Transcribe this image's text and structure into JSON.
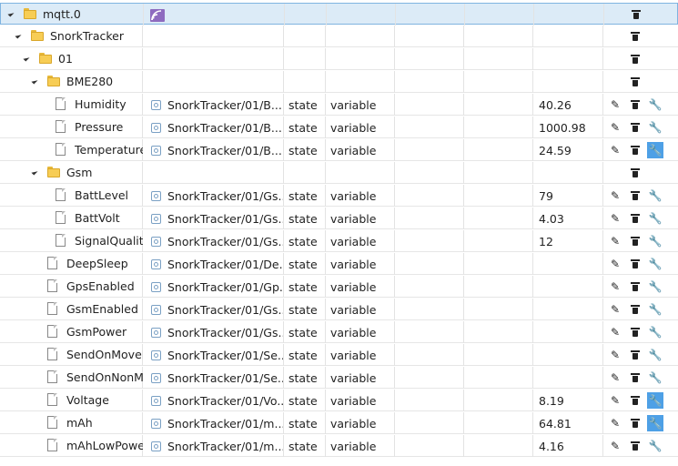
{
  "root": {
    "name": "mqtt.0"
  },
  "colors": {
    "selected_row_bg": "#dcebf7",
    "selected_row_border": "#7fb4e0",
    "active_button": "#4ea0e6",
    "folder": "#f7cd55"
  },
  "rows": [
    {
      "kind": "folder",
      "level": 0,
      "name": "mqtt.0",
      "selected": true,
      "logo": true,
      "buttons": [
        "delete"
      ]
    },
    {
      "kind": "folder",
      "level": 1,
      "name": "SnorkTracker",
      "buttons": [
        "delete"
      ]
    },
    {
      "kind": "folder",
      "level": 2,
      "name": "01",
      "buttons": [
        "delete"
      ]
    },
    {
      "kind": "folder",
      "level": 3,
      "name": "BME280",
      "buttons": [
        "delete"
      ]
    },
    {
      "kind": "state",
      "level": 4,
      "name": "Humidity",
      "id": "SnorkTracker/01/B...",
      "type": "state",
      "role": "variable",
      "value": "40.26",
      "buttons": [
        "edit",
        "delete",
        "settings"
      ],
      "settings_active": false
    },
    {
      "kind": "state",
      "level": 4,
      "name": "Pressure",
      "id": "SnorkTracker/01/B...",
      "type": "state",
      "role": "variable",
      "value": "1000.98",
      "buttons": [
        "edit",
        "delete",
        "settings"
      ],
      "settings_active": false
    },
    {
      "kind": "state",
      "level": 4,
      "name": "Temperature",
      "id": "SnorkTracker/01/B...",
      "type": "state",
      "role": "variable",
      "value": "24.59",
      "buttons": [
        "edit",
        "delete",
        "settings"
      ],
      "settings_active": true
    },
    {
      "kind": "folder",
      "level": 3,
      "name": "Gsm",
      "buttons": [
        "delete"
      ]
    },
    {
      "kind": "state",
      "level": 4,
      "name": "BattLevel",
      "id": "SnorkTracker/01/Gs...",
      "type": "state",
      "role": "variable",
      "value": "79",
      "buttons": [
        "edit",
        "delete",
        "settings"
      ],
      "settings_active": false
    },
    {
      "kind": "state",
      "level": 4,
      "name": "BattVolt",
      "id": "SnorkTracker/01/Gs...",
      "type": "state",
      "role": "variable",
      "value": "4.03",
      "buttons": [
        "edit",
        "delete",
        "settings"
      ],
      "settings_active": false
    },
    {
      "kind": "state",
      "level": 4,
      "name": "SignalQuality",
      "id": "SnorkTracker/01/Gs...",
      "type": "state",
      "role": "variable",
      "value": "12",
      "buttons": [
        "edit",
        "delete",
        "settings"
      ],
      "settings_active": false
    },
    {
      "kind": "state",
      "level": 3,
      "name": "DeepSleep",
      "id": "SnorkTracker/01/De...",
      "type": "state",
      "role": "variable",
      "value": "",
      "buttons": [
        "edit",
        "delete",
        "settings"
      ],
      "settings_active": false
    },
    {
      "kind": "state",
      "level": 3,
      "name": "GpsEnabled",
      "id": "SnorkTracker/01/Gp...",
      "type": "state",
      "role": "variable",
      "value": "",
      "buttons": [
        "edit",
        "delete",
        "settings"
      ],
      "settings_active": false
    },
    {
      "kind": "state",
      "level": 3,
      "name": "GsmEnabled",
      "id": "SnorkTracker/01/Gs...",
      "type": "state",
      "role": "variable",
      "value": "",
      "buttons": [
        "edit",
        "delete",
        "settings"
      ],
      "settings_active": false
    },
    {
      "kind": "state",
      "level": 3,
      "name": "GsmPower",
      "id": "SnorkTracker/01/Gs...",
      "type": "state",
      "role": "variable",
      "value": "",
      "buttons": [
        "edit",
        "delete",
        "settings"
      ],
      "settings_active": false
    },
    {
      "kind": "state",
      "level": 3,
      "name": "SendOnMoveE",
      "id": "SnorkTracker/01/Se...",
      "type": "state",
      "role": "variable",
      "value": "",
      "buttons": [
        "edit",
        "delete",
        "settings"
      ],
      "settings_active": false
    },
    {
      "kind": "state",
      "level": 3,
      "name": "SendOnNonM",
      "id": "SnorkTracker/01/Se...",
      "type": "state",
      "role": "variable",
      "value": "",
      "buttons": [
        "edit",
        "delete",
        "settings"
      ],
      "settings_active": false
    },
    {
      "kind": "state",
      "level": 3,
      "name": "Voltage",
      "id": "SnorkTracker/01/Vo...",
      "type": "state",
      "role": "variable",
      "value": "8.19",
      "buttons": [
        "edit",
        "delete",
        "settings"
      ],
      "settings_active": true
    },
    {
      "kind": "state",
      "level": 3,
      "name": "mAh",
      "id": "SnorkTracker/01/m...",
      "type": "state",
      "role": "variable",
      "value": "64.81",
      "buttons": [
        "edit",
        "delete",
        "settings"
      ],
      "settings_active": true
    },
    {
      "kind": "state",
      "level": 3,
      "name": "mAhLowPower",
      "id": "SnorkTracker/01/m...",
      "type": "state",
      "role": "variable",
      "value": "4.16",
      "buttons": [
        "edit",
        "delete",
        "settings"
      ],
      "settings_active": false
    }
  ],
  "icons": {
    "edit": "pencil-icon",
    "delete": "trash-icon",
    "settings": "wrench-icon",
    "toggle": "expand-triangle-icon"
  }
}
